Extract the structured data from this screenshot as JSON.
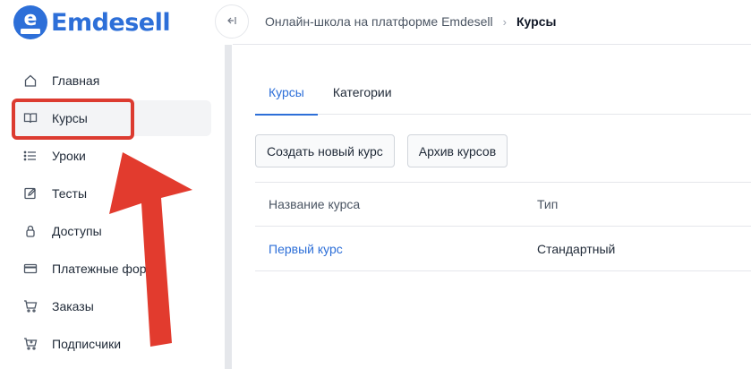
{
  "app": {
    "name": "Emdesell",
    "brand_color": "#2d6fd8",
    "annotation_color": "#dc3b30"
  },
  "sidebar": {
    "items": [
      {
        "label": "Главная",
        "icon": "home-icon"
      },
      {
        "label": "Курсы",
        "icon": "book-icon",
        "active": true
      },
      {
        "label": "Уроки",
        "icon": "list-icon"
      },
      {
        "label": "Тесты",
        "icon": "edit-icon"
      },
      {
        "label": "Доступы",
        "icon": "lock-icon"
      },
      {
        "label": "Платежные формы",
        "icon": "credit-card-icon"
      },
      {
        "label": "Заказы",
        "icon": "cart-icon"
      },
      {
        "label": "Подписчики",
        "icon": "cart-plus-icon"
      }
    ]
  },
  "header": {
    "collapse_icon": "collapse-sidebar-icon",
    "breadcrumb": [
      {
        "label": "Онлайн-школа на платформе Emdesell"
      },
      {
        "label": "Курсы"
      }
    ]
  },
  "main": {
    "tabs": [
      {
        "label": "Курсы",
        "active": true
      },
      {
        "label": "Категории"
      }
    ],
    "buttons": {
      "create": "Создать новый курс",
      "archive": "Архив курсов"
    },
    "table": {
      "columns": [
        "Название курса",
        "Тип"
      ],
      "rows": [
        [
          "Первый курс",
          "Стандартный"
        ]
      ]
    }
  }
}
